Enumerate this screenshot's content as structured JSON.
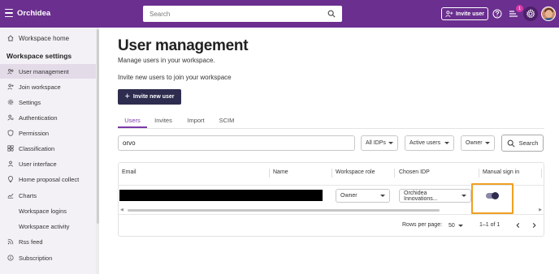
{
  "app": {
    "title": "Orchidea"
  },
  "topbar": {
    "search_placeholder": "Search",
    "invite_label": "Invite user",
    "notification_count": "1"
  },
  "sidebar": {
    "workspace_home": "Workspace home",
    "section_title": "Workspace settings",
    "items": [
      {
        "label": "User management",
        "icon": "users-cog-icon",
        "active": true
      },
      {
        "label": "Join workspace",
        "icon": "person-add-icon"
      },
      {
        "label": "Settings",
        "icon": "gear-icon"
      },
      {
        "label": "Authentication",
        "icon": "key-person-icon"
      },
      {
        "label": "Permission",
        "icon": "shield-icon"
      },
      {
        "label": "Classification",
        "icon": "category-icon"
      },
      {
        "label": "User interface",
        "icon": "user-interface-icon"
      },
      {
        "label": "Home proposal collect",
        "icon": "lightbulb-icon"
      },
      {
        "label": "Charts",
        "icon": "chart-icon"
      },
      {
        "label": "Workspace logins",
        "icon": ""
      },
      {
        "label": "Workspace activity",
        "icon": ""
      },
      {
        "label": "Rss feed",
        "icon": "rss-icon"
      },
      {
        "label": "Subscription",
        "icon": "info-icon"
      }
    ]
  },
  "main": {
    "title": "User management",
    "subtitle": "Manage users in your workspace.",
    "invite_text": "Invite new users to join your workspace",
    "invite_button": "Invite new user",
    "tabs": [
      "Users",
      "Invites",
      "Import",
      "SCIM"
    ],
    "active_tab": "Users"
  },
  "filters": {
    "search_value": "orvo",
    "idp": "All IDPs",
    "status": "Active users",
    "role": "Owner",
    "search_button": "Search"
  },
  "table": {
    "columns": [
      "Email",
      "Name",
      "Workspace role",
      "Chosen IDP",
      "Manual sign in"
    ],
    "rows": [
      {
        "email": "",
        "name": "",
        "role": "Owner",
        "idp": "Orchidea Innovations...",
        "manual_sign_in": true
      }
    ],
    "rows_per_page_label": "Rows per page:",
    "rows_per_page": "50",
    "range": "1–1 of 1"
  },
  "colors": {
    "brand": "#6b2f8f",
    "primary_button": "#2e2d4f",
    "highlight": "#f0a020",
    "tab_active": "#7b3aa8"
  }
}
